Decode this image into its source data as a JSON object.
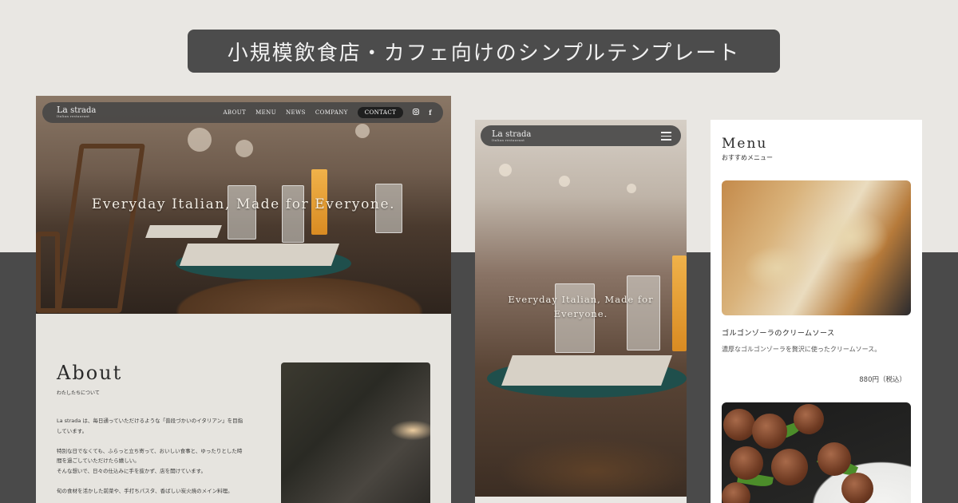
{
  "banner": {
    "text": "小規模飲食店・カフェ向けのシンプルテンプレート"
  },
  "brand": {
    "name_main": "La",
    "name_rest": "strada",
    "tagline": "Italian restaurant"
  },
  "desktop": {
    "nav": [
      "ABOUT",
      "MENU",
      "NEWS",
      "COMPANY"
    ],
    "contact_label": "CONTACT",
    "social_icons": [
      "instagram-icon",
      "facebook-icon"
    ],
    "hero_title": "Everyday Italian, Made for Everyone.",
    "about": {
      "title": "About",
      "subtitle": "わたしたちについて",
      "body": "La strada は、毎日通っていただけるような「普段づかいのイタリアン」を目指しています。\n\n特別な日でなくても、ふらっと立ち寄って、おいしい食事と、ゆったりとした時間を過ごしていただけたら嬉しい。\nそんな想いで、日々の仕込みに手を抜かず、店を開けています。\n\n旬の食材を活かした前菜や、手打ちパスタ、香ばしい炭火焼のメイン料理。"
    }
  },
  "mobile": {
    "hero_title": "Everyday Italian, Made for Everyone.",
    "menu_icon": "hamburger-icon"
  },
  "menu_card": {
    "title": "Menu",
    "subtitle": "おすすめメニュー",
    "item": {
      "name": "ゴルゴンゾーラのクリームソース",
      "description": "濃厚なゴルゴンゾーラを贅沢に使ったクリームソース。",
      "price": "880円（税込）"
    }
  },
  "colors": {
    "dark_band": "#4a4a4a",
    "light_bg": "#e9e7e3",
    "nav_bg": "#464646"
  }
}
